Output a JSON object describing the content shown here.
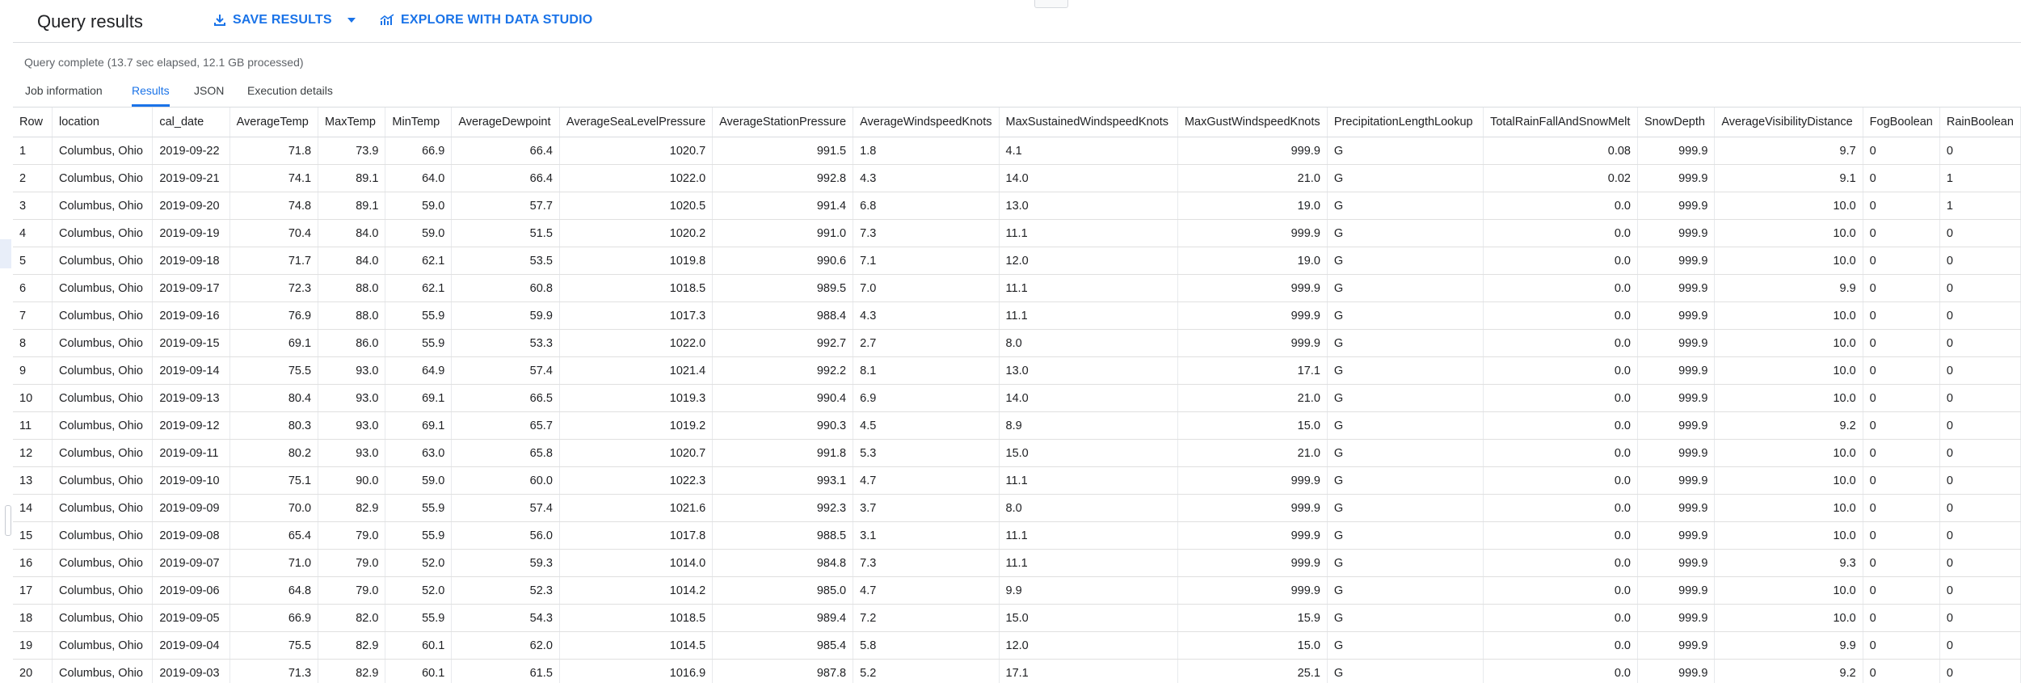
{
  "header": {
    "title": "Query results",
    "save_label": "SAVE RESULTS",
    "explore_label": "EXPLORE WITH DATA STUDIO"
  },
  "status": "Query complete (13.7 sec elapsed, 12.1 GB processed)",
  "tabs": [
    {
      "label": "Job information",
      "active": false
    },
    {
      "label": "Results",
      "active": true
    },
    {
      "label": "JSON",
      "active": false
    },
    {
      "label": "Execution details",
      "active": false
    }
  ],
  "colors": {
    "accent": "#1a73e8",
    "border": "#dadce0",
    "text": "#202124",
    "muted": "#5f6368"
  },
  "icons": {
    "save": "download-icon",
    "save_menu": "caret-down-icon",
    "explore": "chart-icon"
  },
  "table": {
    "columns": [
      "Row",
      "location",
      "cal_date",
      "AverageTemp",
      "MaxTemp",
      "MinTemp",
      "AverageDewpoint",
      "AverageSeaLevelPressure",
      "AverageStationPressure",
      "AverageWindspeedKnots",
      "MaxSustainedWindspeedKnots",
      "MaxGustWindspeedKnots",
      "PrecipitationLengthLookup",
      "TotalRainFallAndSnowMelt",
      "SnowDepth",
      "AverageVisibilityDistance",
      "FogBoolean",
      "RainBoolean"
    ],
    "rows": [
      [
        "1",
        "Columbus, Ohio",
        "2019-09-22",
        "71.8",
        "73.9",
        "66.9",
        "66.4",
        "1020.7",
        "991.5",
        "1.8",
        "4.1",
        "999.9",
        "G",
        "0.08",
        "999.9",
        "9.7",
        "0",
        "0"
      ],
      [
        "2",
        "Columbus, Ohio",
        "2019-09-21",
        "74.1",
        "89.1",
        "64.0",
        "66.4",
        "1022.0",
        "992.8",
        "4.3",
        "14.0",
        "21.0",
        "G",
        "0.02",
        "999.9",
        "9.1",
        "0",
        "1"
      ],
      [
        "3",
        "Columbus, Ohio",
        "2019-09-20",
        "74.8",
        "89.1",
        "59.0",
        "57.7",
        "1020.5",
        "991.4",
        "6.8",
        "13.0",
        "19.0",
        "G",
        "0.0",
        "999.9",
        "10.0",
        "0",
        "1"
      ],
      [
        "4",
        "Columbus, Ohio",
        "2019-09-19",
        "70.4",
        "84.0",
        "59.0",
        "51.5",
        "1020.2",
        "991.0",
        "7.3",
        "11.1",
        "999.9",
        "G",
        "0.0",
        "999.9",
        "10.0",
        "0",
        "0"
      ],
      [
        "5",
        "Columbus, Ohio",
        "2019-09-18",
        "71.7",
        "84.0",
        "62.1",
        "53.5",
        "1019.8",
        "990.6",
        "7.1",
        "12.0",
        "19.0",
        "G",
        "0.0",
        "999.9",
        "10.0",
        "0",
        "0"
      ],
      [
        "6",
        "Columbus, Ohio",
        "2019-09-17",
        "72.3",
        "88.0",
        "62.1",
        "60.8",
        "1018.5",
        "989.5",
        "7.0",
        "11.1",
        "999.9",
        "G",
        "0.0",
        "999.9",
        "9.9",
        "0",
        "0"
      ],
      [
        "7",
        "Columbus, Ohio",
        "2019-09-16",
        "76.9",
        "88.0",
        "55.9",
        "59.9",
        "1017.3",
        "988.4",
        "4.3",
        "11.1",
        "999.9",
        "G",
        "0.0",
        "999.9",
        "10.0",
        "0",
        "0"
      ],
      [
        "8",
        "Columbus, Ohio",
        "2019-09-15",
        "69.1",
        "86.0",
        "55.9",
        "53.3",
        "1022.0",
        "992.7",
        "2.7",
        "8.0",
        "999.9",
        "G",
        "0.0",
        "999.9",
        "10.0",
        "0",
        "0"
      ],
      [
        "9",
        "Columbus, Ohio",
        "2019-09-14",
        "75.5",
        "93.0",
        "64.9",
        "57.4",
        "1021.4",
        "992.2",
        "8.1",
        "13.0",
        "17.1",
        "G",
        "0.0",
        "999.9",
        "10.0",
        "0",
        "0"
      ],
      [
        "10",
        "Columbus, Ohio",
        "2019-09-13",
        "80.4",
        "93.0",
        "69.1",
        "66.5",
        "1019.3",
        "990.4",
        "6.9",
        "14.0",
        "21.0",
        "G",
        "0.0",
        "999.9",
        "10.0",
        "0",
        "0"
      ],
      [
        "11",
        "Columbus, Ohio",
        "2019-09-12",
        "80.3",
        "93.0",
        "69.1",
        "65.7",
        "1019.2",
        "990.3",
        "4.5",
        "8.9",
        "15.0",
        "G",
        "0.0",
        "999.9",
        "9.2",
        "0",
        "0"
      ],
      [
        "12",
        "Columbus, Ohio",
        "2019-09-11",
        "80.2",
        "93.0",
        "63.0",
        "65.8",
        "1020.7",
        "991.8",
        "5.3",
        "15.0",
        "21.0",
        "G",
        "0.0",
        "999.9",
        "10.0",
        "0",
        "0"
      ],
      [
        "13",
        "Columbus, Ohio",
        "2019-09-10",
        "75.1",
        "90.0",
        "59.0",
        "60.0",
        "1022.3",
        "993.1",
        "4.7",
        "11.1",
        "999.9",
        "G",
        "0.0",
        "999.9",
        "10.0",
        "0",
        "0"
      ],
      [
        "14",
        "Columbus, Ohio",
        "2019-09-09",
        "70.0",
        "82.9",
        "55.9",
        "57.4",
        "1021.6",
        "992.3",
        "3.7",
        "8.0",
        "999.9",
        "G",
        "0.0",
        "999.9",
        "10.0",
        "0",
        "0"
      ],
      [
        "15",
        "Columbus, Ohio",
        "2019-09-08",
        "65.4",
        "79.0",
        "55.9",
        "56.0",
        "1017.8",
        "988.5",
        "3.1",
        "11.1",
        "999.9",
        "G",
        "0.0",
        "999.9",
        "10.0",
        "0",
        "0"
      ],
      [
        "16",
        "Columbus, Ohio",
        "2019-09-07",
        "71.0",
        "79.0",
        "52.0",
        "59.3",
        "1014.0",
        "984.8",
        "7.3",
        "11.1",
        "999.9",
        "G",
        "0.0",
        "999.9",
        "9.3",
        "0",
        "0"
      ],
      [
        "17",
        "Columbus, Ohio",
        "2019-09-06",
        "64.8",
        "79.0",
        "52.0",
        "52.3",
        "1014.2",
        "985.0",
        "4.7",
        "9.9",
        "999.9",
        "G",
        "0.0",
        "999.9",
        "10.0",
        "0",
        "0"
      ],
      [
        "18",
        "Columbus, Ohio",
        "2019-09-05",
        "66.9",
        "82.0",
        "55.9",
        "54.3",
        "1018.5",
        "989.4",
        "7.2",
        "15.0",
        "15.9",
        "G",
        "0.0",
        "999.9",
        "10.0",
        "0",
        "0"
      ],
      [
        "19",
        "Columbus, Ohio",
        "2019-09-04",
        "75.5",
        "82.9",
        "60.1",
        "62.0",
        "1014.5",
        "985.4",
        "5.8",
        "12.0",
        "15.0",
        "G",
        "0.0",
        "999.9",
        "9.9",
        "0",
        "0"
      ],
      [
        "20",
        "Columbus, Ohio",
        "2019-09-03",
        "71.3",
        "82.9",
        "60.1",
        "61.5",
        "1016.9",
        "987.8",
        "5.2",
        "17.1",
        "25.1",
        "G",
        "0.0",
        "999.9",
        "9.2",
        "0",
        "0"
      ]
    ]
  }
}
